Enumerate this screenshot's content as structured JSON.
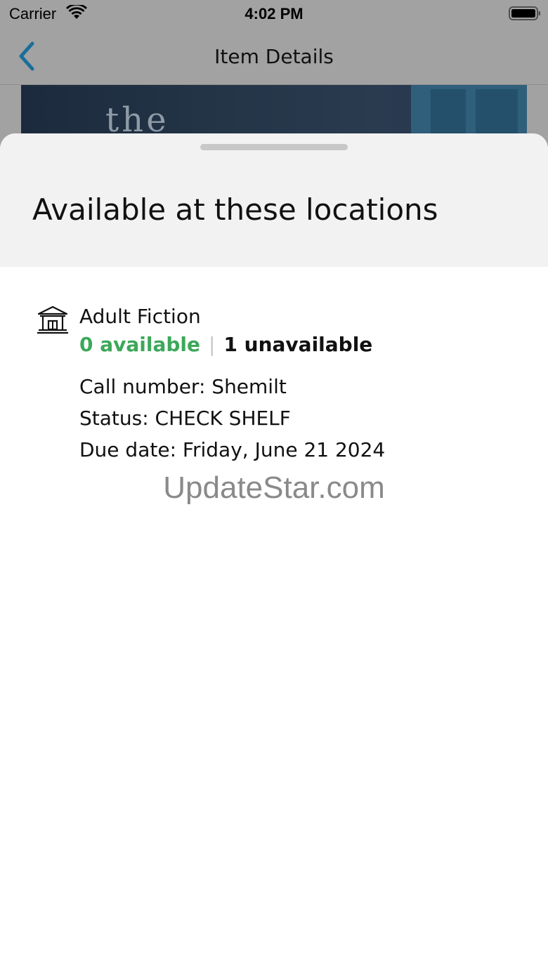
{
  "status_bar": {
    "carrier": "Carrier",
    "time": "4:02 PM"
  },
  "nav": {
    "title": "Item Details",
    "accent_color": "#1a7fb5"
  },
  "cover": {
    "visible_text": "the"
  },
  "sheet": {
    "title": "Available at these locations",
    "location": {
      "name": "Adult Fiction",
      "available": "0 available",
      "separator": "|",
      "unavailable": "1 unavailable",
      "call_number": "Call number: Shemilt",
      "status": "Status: CHECK SHELF",
      "due_date": "Due date: Friday, June 21 2024"
    }
  },
  "watermark": "UpdateStar.com",
  "colors": {
    "available_green": "#3ca85a",
    "sheet_header_bg": "#f2f2f2",
    "dimmed_bg": "#a2a2a2"
  }
}
